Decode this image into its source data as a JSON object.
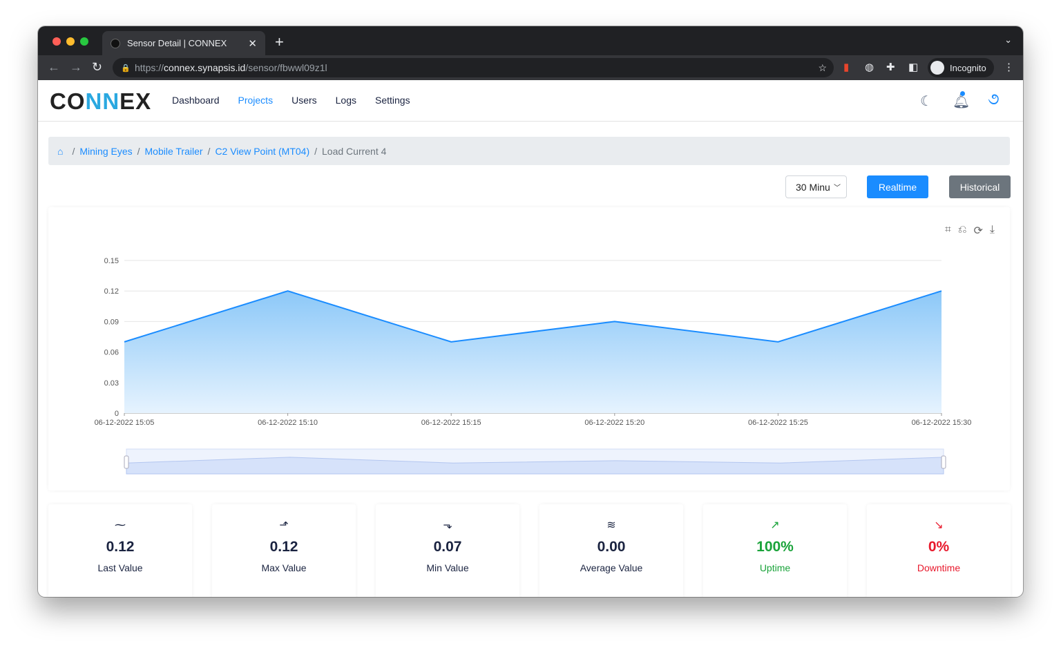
{
  "browser": {
    "tab_title": "Sensor Detail | CONNEX",
    "url_scheme": "https://",
    "url_host": "connex.synapsis.id",
    "url_path": "/sensor/fbwwl09z1l",
    "profile": "Incognito"
  },
  "app": {
    "logo": "CONNEX",
    "menu": [
      {
        "label": "Dashboard",
        "active": false
      },
      {
        "label": "Projects",
        "active": true
      },
      {
        "label": "Users",
        "active": false
      },
      {
        "label": "Logs",
        "active": false
      },
      {
        "label": "Settings",
        "active": false
      }
    ]
  },
  "breadcrumb": [
    "Mining Eyes",
    "Mobile Trailer",
    "C2 View Point (MT04)",
    "Load Current 4"
  ],
  "controls": {
    "range": "30 Minu",
    "realtime": "Realtime",
    "historical": "Historical",
    "accent": "#1a8cff",
    "secondary": "#6c757d"
  },
  "chart_data": {
    "type": "area",
    "x": [
      "06-12-2022 15:05",
      "06-12-2022 15:10",
      "06-12-2022 15:15",
      "06-12-2022 15:20",
      "06-12-2022 15:25",
      "06-12-2022 15:30"
    ],
    "values": [
      0.07,
      0.12,
      0.07,
      0.09,
      0.07,
      0.12
    ],
    "yticks": [
      "0",
      "0.03",
      "0.06",
      "0.09",
      "0.12",
      "0.15"
    ],
    "ylim": [
      0,
      0.15
    ],
    "grid": true,
    "color": "#1a8cff",
    "datazoom": true
  },
  "stats": [
    {
      "icon": "line-chart-icon",
      "value": "0.12",
      "label": "Last Value",
      "color": "#1a2340"
    },
    {
      "icon": "chart-up-icon",
      "value": "0.12",
      "label": "Max Value",
      "color": "#1a2340"
    },
    {
      "icon": "chart-down-icon",
      "value": "0.07",
      "label": "Min Value",
      "color": "#1a2340"
    },
    {
      "icon": "average-icon",
      "value": "0.00",
      "label": "Average Value",
      "color": "#1a2340"
    },
    {
      "icon": "trend-up-icon",
      "value": "100%",
      "label": "Uptime",
      "color": "#1aa33a"
    },
    {
      "icon": "trend-down-icon",
      "value": "0%",
      "label": "Downtime",
      "color": "#e8192c"
    }
  ]
}
